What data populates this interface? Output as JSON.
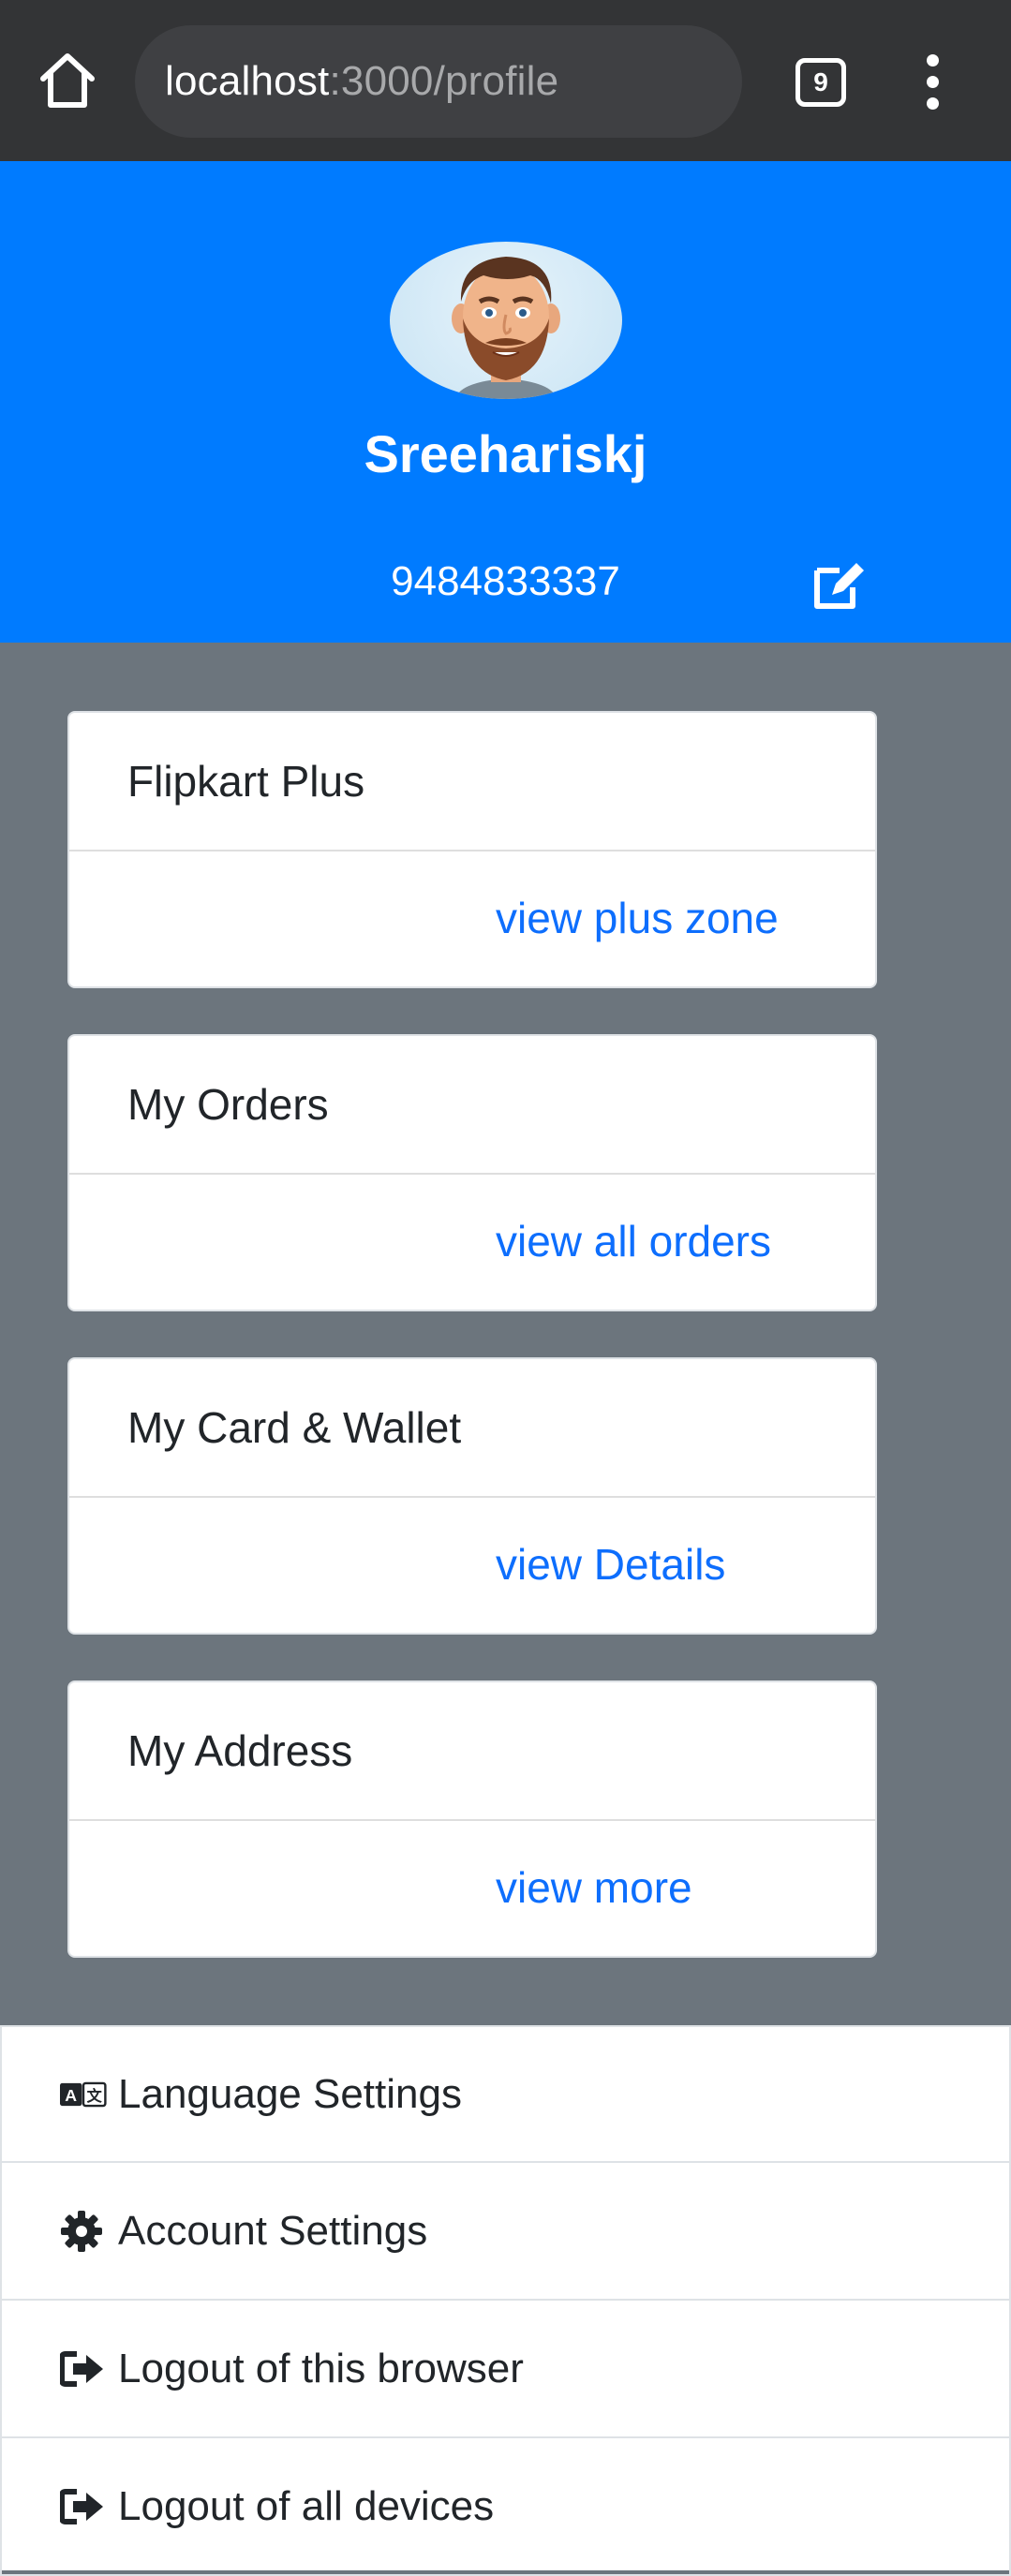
{
  "browser": {
    "url_host": "localhost",
    "url_path": ":3000/profile",
    "tab_count": "9"
  },
  "profile": {
    "name": "Sreehariskj",
    "phone": "9484833337"
  },
  "cards": [
    {
      "title": "Flipkart Plus",
      "link": "view plus zone"
    },
    {
      "title": "My Orders",
      "link": "view all orders"
    },
    {
      "title": "My Card & Wallet",
      "link": "view Details"
    },
    {
      "title": "My Address",
      "link": "view more"
    }
  ],
  "settings": [
    {
      "label": "Language Settings",
      "icon": "language-icon"
    },
    {
      "label": "Account Settings",
      "icon": "gear-icon"
    },
    {
      "label": "Logout of this browser",
      "icon": "sign-out-icon"
    },
    {
      "label": "Logout of all devices",
      "icon": "sign-out-icon"
    }
  ],
  "colors": {
    "header_bg": "#007bff",
    "page_bg": "#6c757d",
    "link": "#0d6efd",
    "chrome_bg": "#333436"
  }
}
